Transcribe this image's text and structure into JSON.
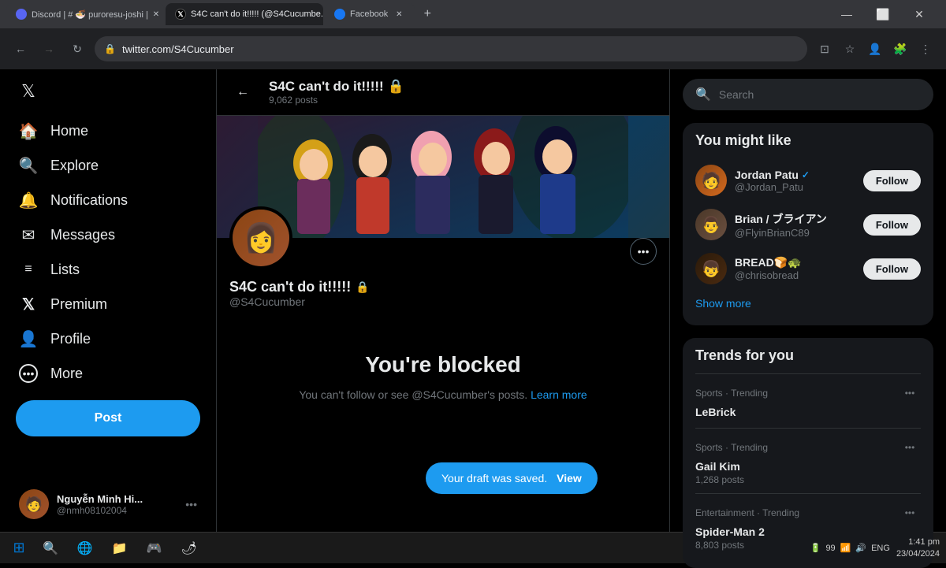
{
  "browser": {
    "tabs": [
      {
        "id": "discord",
        "label": "Discord | # 🍜 puroresu-joshi |",
        "favicon_color": "#5865f2",
        "active": false
      },
      {
        "id": "twitter",
        "label": "S4C can't do it!!!!! (@S4Cucumbe...",
        "favicon_color": "#1d9bf0",
        "active": true
      },
      {
        "id": "facebook",
        "label": "Facebook",
        "favicon_color": "#1877f2",
        "active": false
      }
    ],
    "address": "twitter.com/S4Cucumber",
    "nav": {
      "back": "←",
      "forward": "→",
      "refresh": "↻"
    }
  },
  "sidebar": {
    "logo": "𝕏",
    "nav_items": [
      {
        "id": "home",
        "icon": "🏠",
        "label": "Home"
      },
      {
        "id": "explore",
        "icon": "🔍",
        "label": "Explore"
      },
      {
        "id": "notifications",
        "icon": "🔔",
        "label": "Notifications"
      },
      {
        "id": "messages",
        "icon": "✉",
        "label": "Messages"
      },
      {
        "id": "lists",
        "icon": "☰",
        "label": "Lists"
      },
      {
        "id": "premium",
        "icon": "𝕏",
        "label": "Premium"
      },
      {
        "id": "profile",
        "icon": "👤",
        "label": "Profile"
      },
      {
        "id": "more",
        "icon": "⊕",
        "label": "More"
      }
    ],
    "post_button": "Post",
    "footer": {
      "name": "Nguyễn Minh Hi...",
      "handle": "@nmh08102004"
    }
  },
  "profile": {
    "back_arrow": "←",
    "display_name": "S4C can't do it!!!!!",
    "lock_symbol": "🔒",
    "posts_count": "9,062 posts",
    "handle": "@S4Cucumber",
    "more_icon": "•••"
  },
  "blocked": {
    "title": "You're blocked",
    "description": "You can't follow or see @S4Cucumber's posts.",
    "learn_more": "Learn more"
  },
  "toast": {
    "text": "Your draft was saved.",
    "view_label": "View"
  },
  "right_sidebar": {
    "search_placeholder": "Search",
    "might_like": {
      "title": "You might like",
      "users": [
        {
          "name": "Jordan Patu",
          "handle": "@Jordan_Patu",
          "verified": true,
          "avatar_color": "#8b4513"
        },
        {
          "name": "Brian / ブライアン",
          "handle": "@FlyinBrianC89",
          "verified": false,
          "avatar_color": "#4a3728"
        },
        {
          "name": "BREAD🍞🐢",
          "handle": "@chrisobread",
          "verified": false,
          "avatar_color": "#2a1a0a"
        }
      ],
      "follow_label": "Follow",
      "show_more": "Show more"
    },
    "trends": {
      "title": "Trends for you",
      "items": [
        {
          "category": "Sports · Trending",
          "topic": "LeBrick",
          "posts": null
        },
        {
          "category": "Sports · Trending",
          "topic": "Gail Kim",
          "posts": "1,268 posts"
        },
        {
          "category": "Entertainment · Trending",
          "topic": "Spider-Man 2",
          "posts": "8,803 posts"
        }
      ]
    }
  },
  "taskbar": {
    "start_icon": "⊞",
    "apps": [
      {
        "icon": "🔍",
        "label": "Search",
        "color": "#4a90d9"
      },
      {
        "icon": "🌐",
        "label": "Browser",
        "color": "#1877f2"
      },
      {
        "icon": "📁",
        "label": "Files",
        "color": "#f0a500"
      },
      {
        "icon": "🎮",
        "label": "Game",
        "color": "#4caf50"
      },
      {
        "icon": "🌶",
        "label": "App",
        "color": "#e53935"
      }
    ],
    "systray": {
      "battery": "99",
      "lang": "ENG",
      "time": "1:41 pm",
      "date": "23/04/2024"
    }
  }
}
